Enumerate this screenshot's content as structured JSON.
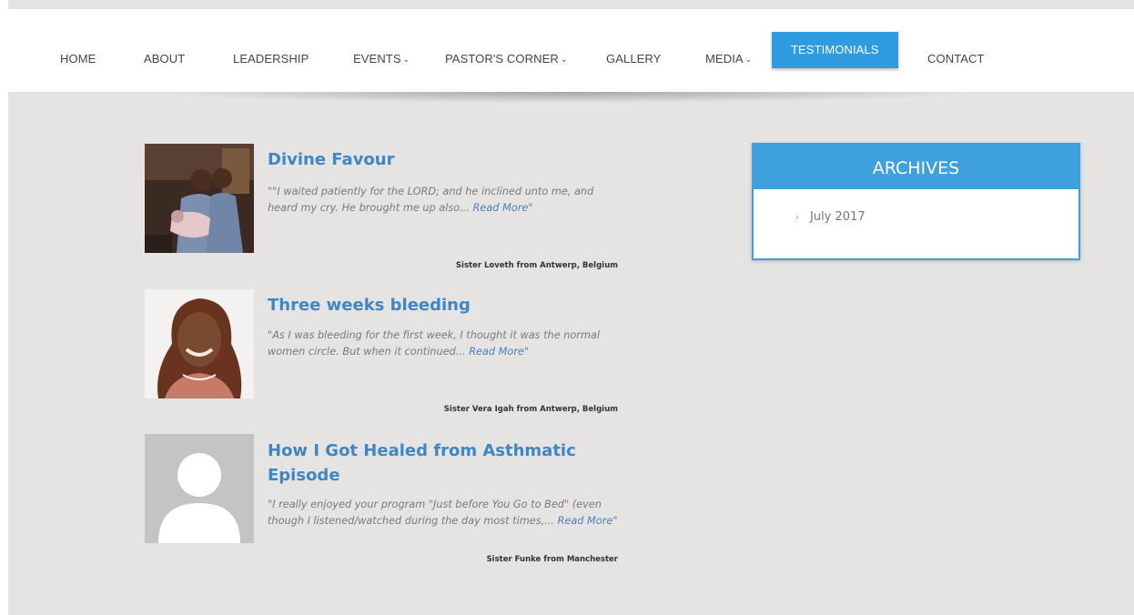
{
  "nav": {
    "items": [
      {
        "label": "HOME",
        "dropdown": false,
        "active": false
      },
      {
        "label": "ABOUT",
        "dropdown": false,
        "active": false
      },
      {
        "label": "LEADERSHIP",
        "dropdown": false,
        "active": false
      },
      {
        "label": "EVENTS",
        "dropdown": true,
        "active": false
      },
      {
        "label": "PASTOR'S CORNER",
        "dropdown": true,
        "active": false
      },
      {
        "label": "GALLERY",
        "dropdown": false,
        "active": false
      },
      {
        "label": "MEDIA",
        "dropdown": true,
        "active": false
      },
      {
        "label": "TESTIMONIALS",
        "dropdown": false,
        "active": true
      },
      {
        "label": "CONTACT",
        "dropdown": false,
        "active": false
      }
    ],
    "chevron_glyph": "⌄",
    "active_color": "#2f9be0"
  },
  "testimonials": [
    {
      "title": "Divine Favour",
      "quote": "\"\"I waited patiently for the LORD; and he inclined unto me, and heard my cry. He brought me up also...",
      "read_more": "Read More",
      "quote_end": "\"",
      "author": "Sister Loveth from Antwerp, Belgium",
      "image": "family-photo"
    },
    {
      "title": "Three weeks bleeding",
      "quote": "\"As I was bleeding for the first week, I thought it was the normal women circle. But when it continued...",
      "read_more": "Read More",
      "quote_end": "\"",
      "author": "Sister Vera Igah from Antwerp, Belgium",
      "image": "woman-portrait"
    },
    {
      "title": "How I Got Healed from Asthmatic Episode",
      "quote": "\"I really enjoyed your program \"Just before You Go to Bed\" (even though I listened/watched during the day most times,...",
      "read_more": "Read More",
      "quote_end": "\"",
      "author": "Sister Funke from Manchester",
      "image": "avatar-placeholder"
    }
  ],
  "archives": {
    "title": "ARCHIVES",
    "items": [
      {
        "arrow": "›",
        "label": "July 2017"
      }
    ]
  },
  "colors": {
    "title_blue": "#3f86c6",
    "archives_blue": "#3ea1de",
    "background": "#e6e4e2"
  }
}
